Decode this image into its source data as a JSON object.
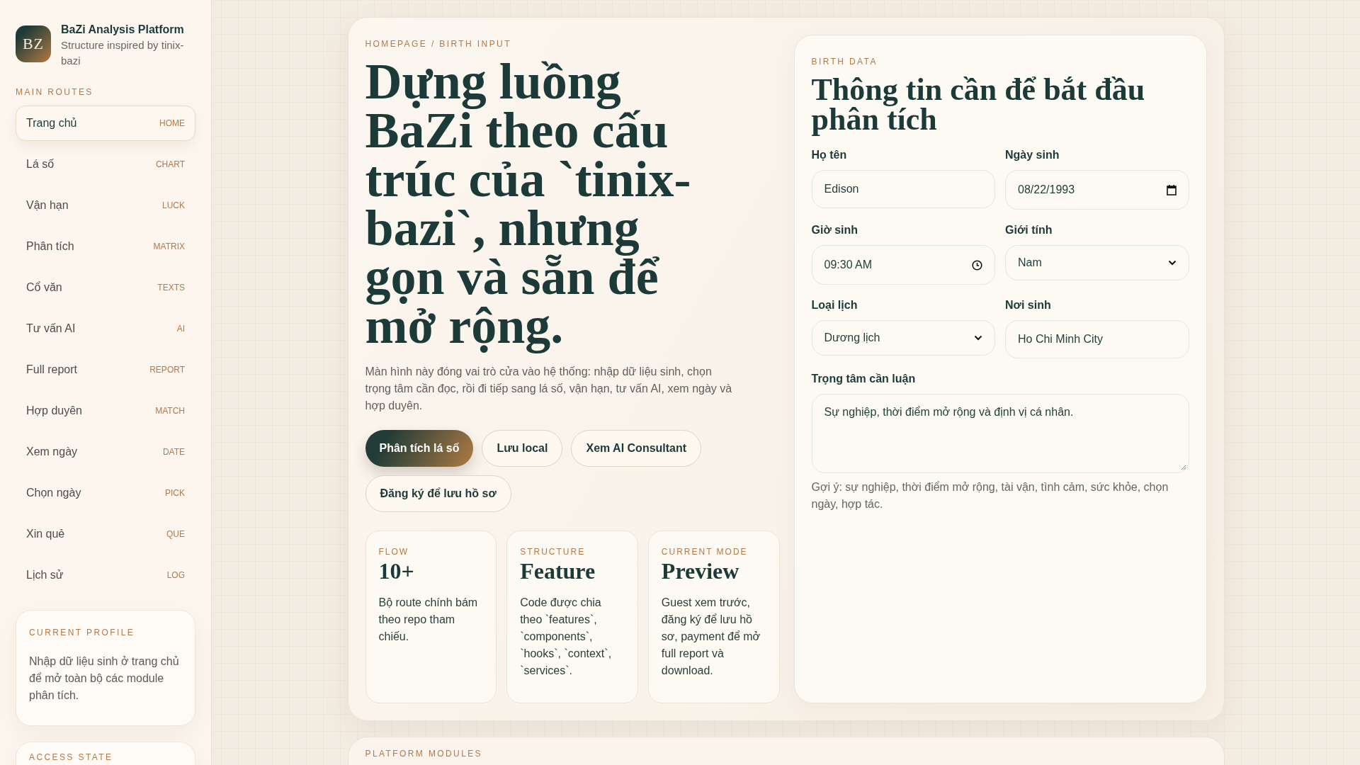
{
  "brand": {
    "logo": "BZ",
    "title": "BaZi Analysis Platform",
    "subtitle": "Structure inspired by tinix-bazi"
  },
  "sidebar": {
    "heading": "MAIN ROUTES",
    "items": [
      {
        "label": "Trang chủ",
        "tag": "HOME",
        "selected": true
      },
      {
        "label": "Lá số",
        "tag": "CHART",
        "selected": false
      },
      {
        "label": "Vận hạn",
        "tag": "LUCK",
        "selected": false
      },
      {
        "label": "Phân tích",
        "tag": "MATRIX",
        "selected": false
      },
      {
        "label": "Cổ văn",
        "tag": "TEXTS",
        "selected": false
      },
      {
        "label": "Tư vấn AI",
        "tag": "AI",
        "selected": false
      },
      {
        "label": "Full report",
        "tag": "REPORT",
        "selected": false
      },
      {
        "label": "Hợp duyên",
        "tag": "MATCH",
        "selected": false
      },
      {
        "label": "Xem ngày",
        "tag": "DATE",
        "selected": false
      },
      {
        "label": "Chọn ngày",
        "tag": "PICK",
        "selected": false
      },
      {
        "label": "Xin quẻ",
        "tag": "QUE",
        "selected": false
      },
      {
        "label": "Lịch sử",
        "tag": "LOG",
        "selected": false
      }
    ]
  },
  "profile_card": {
    "heading": "CURRENT PROFILE",
    "text": "Nhập dữ liệu sinh ở trang chủ để mở toàn bộ các module phân tích."
  },
  "access_card": {
    "heading": "ACCESS STATE"
  },
  "hero": {
    "breadcrumb": "HOMEPAGE / BIRTH INPUT",
    "title": "Dựng luồng BaZi theo cấu trúc của `tinix-bazi`, nhưng gọn và sẵn để mở rộng.",
    "description": "Màn hình này đóng vai trò cửa vào hệ thống: nhập dữ liệu sinh, chọn trọng tâm cần đọc, rồi đi tiếp sang lá số, vận hạn, tư vấn AI, xem ngày và hợp duyên.",
    "buttons": [
      {
        "label": "Phân tích lá số",
        "kind": "primary"
      },
      {
        "label": "Lưu local",
        "kind": "secondary"
      },
      {
        "label": "Xem AI Consultant",
        "kind": "secondary"
      },
      {
        "label": "Đăng ký để lưu hồ sơ",
        "kind": "secondary"
      }
    ],
    "stats": [
      {
        "label": "FLOW",
        "value": "10+",
        "text": "Bộ route chính bám theo repo tham chiếu."
      },
      {
        "label": "STRUCTURE",
        "value": "Feature",
        "text": "Code được chia theo `features`, `components`, `hooks`, `context`, `services`."
      },
      {
        "label": "CURRENT MODE",
        "value": "Preview",
        "text": "Guest xem trước, đăng ký để lưu hồ sơ, payment để mở full report và download."
      }
    ]
  },
  "form": {
    "eyebrow": "BIRTH DATA",
    "title": "Thông tin cần để bắt đầu phân tích",
    "fields": [
      {
        "label": "Họ tên",
        "kind": "text",
        "value": "Edison"
      },
      {
        "label": "Ngày sinh",
        "kind": "date",
        "value": "08/22/1993"
      },
      {
        "label": "Giờ sinh",
        "kind": "time",
        "value": "09:30 AM"
      },
      {
        "label": "Giới tính",
        "kind": "select",
        "value": "Nam"
      },
      {
        "label": "Loại lịch",
        "kind": "select",
        "value": "Dương lịch"
      },
      {
        "label": "Nơi sinh",
        "kind": "text",
        "value": "Ho Chi Minh City"
      }
    ],
    "focus": {
      "label": "Trọng tâm cần luận",
      "value": "Sự nghiệp, thời điểm mở rộng và định vị cá nhân.",
      "hint": "Gợi ý: sự nghiệp, thời điểm mở rộng, tài vận, tình cảm, sức khỏe, chọn ngày, hợp tác."
    }
  },
  "modules": {
    "heading": "PLATFORM MODULES"
  }
}
